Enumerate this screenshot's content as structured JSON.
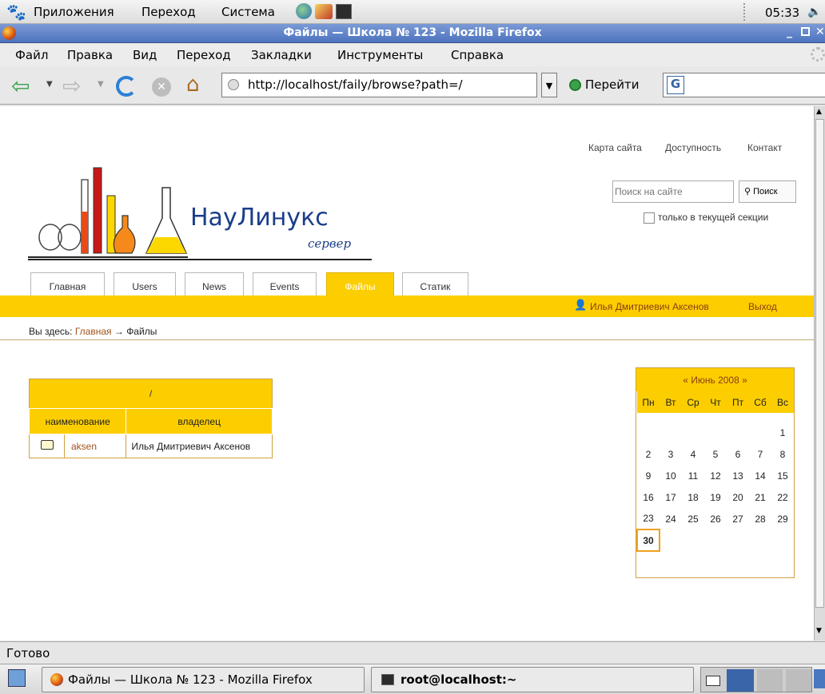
{
  "panel": {
    "menus": [
      "Приложения",
      "Переход",
      "Система"
    ],
    "clock": "05:33"
  },
  "window": {
    "title": "Файлы — Школа № 123 - Mozilla Firefox"
  },
  "menubar": {
    "items": [
      "Файл",
      "Правка",
      "Вид",
      "Переход",
      "Закладки",
      "Инструменты",
      "Справка"
    ]
  },
  "navbar": {
    "url": "http://localhost/faily/browse?path=/",
    "go_label": "Перейти",
    "search_value": ""
  },
  "site": {
    "top_links": [
      "Карта сайта",
      "Доступность",
      "Контакт"
    ],
    "search_placeholder": "Поиск на сайте",
    "search_button": "Поиск",
    "section_checkbox_label": "только в текущей секции",
    "logo_text": "НауЛинукс",
    "logo_sub": "сервер",
    "tabs": [
      "Главная",
      "Users",
      "News",
      "Events",
      "Файлы",
      "Статик"
    ],
    "active_tab": "Файлы",
    "user_name": "Илья Дмитриевич Аксенов",
    "logout": "Выход",
    "breadcrumb_prefix": "Вы здесь:",
    "breadcrumb_home": "Главная",
    "breadcrumb_sep": "→",
    "breadcrumb_current": "Файлы"
  },
  "files": {
    "path": "/",
    "col_name": "наименование",
    "col_owner": "владелец",
    "rows": [
      {
        "name": "aksen",
        "owner": "Илья Дмитриевич Аксенов"
      }
    ]
  },
  "calendar": {
    "header": "« Июнь 2008 »",
    "weekdays": [
      "Пн",
      "Вт",
      "Ср",
      "Чт",
      "Пт",
      "Сб",
      "Вс"
    ],
    "weeks": [
      [
        "",
        "",
        "",
        "",
        "",
        "",
        "1"
      ],
      [
        "2",
        "3",
        "4",
        "5",
        "6",
        "7",
        "8"
      ],
      [
        "9",
        "10",
        "11",
        "12",
        "13",
        "14",
        "15"
      ],
      [
        "16",
        "17",
        "18",
        "19",
        "20",
        "21",
        "22"
      ],
      [
        "23",
        "24",
        "25",
        "26",
        "27",
        "28",
        "29"
      ],
      [
        "30",
        "",
        "",
        "",
        "",
        "",
        ""
      ]
    ],
    "today": "30",
    "accent": "#fcce00",
    "today_border": "#f0a020"
  },
  "status": {
    "text": "Готово"
  },
  "taskbar": {
    "firefox_task": "Файлы — Школа № 123 - Mozilla Firefox",
    "terminal_task": "root@localhost:~"
  }
}
